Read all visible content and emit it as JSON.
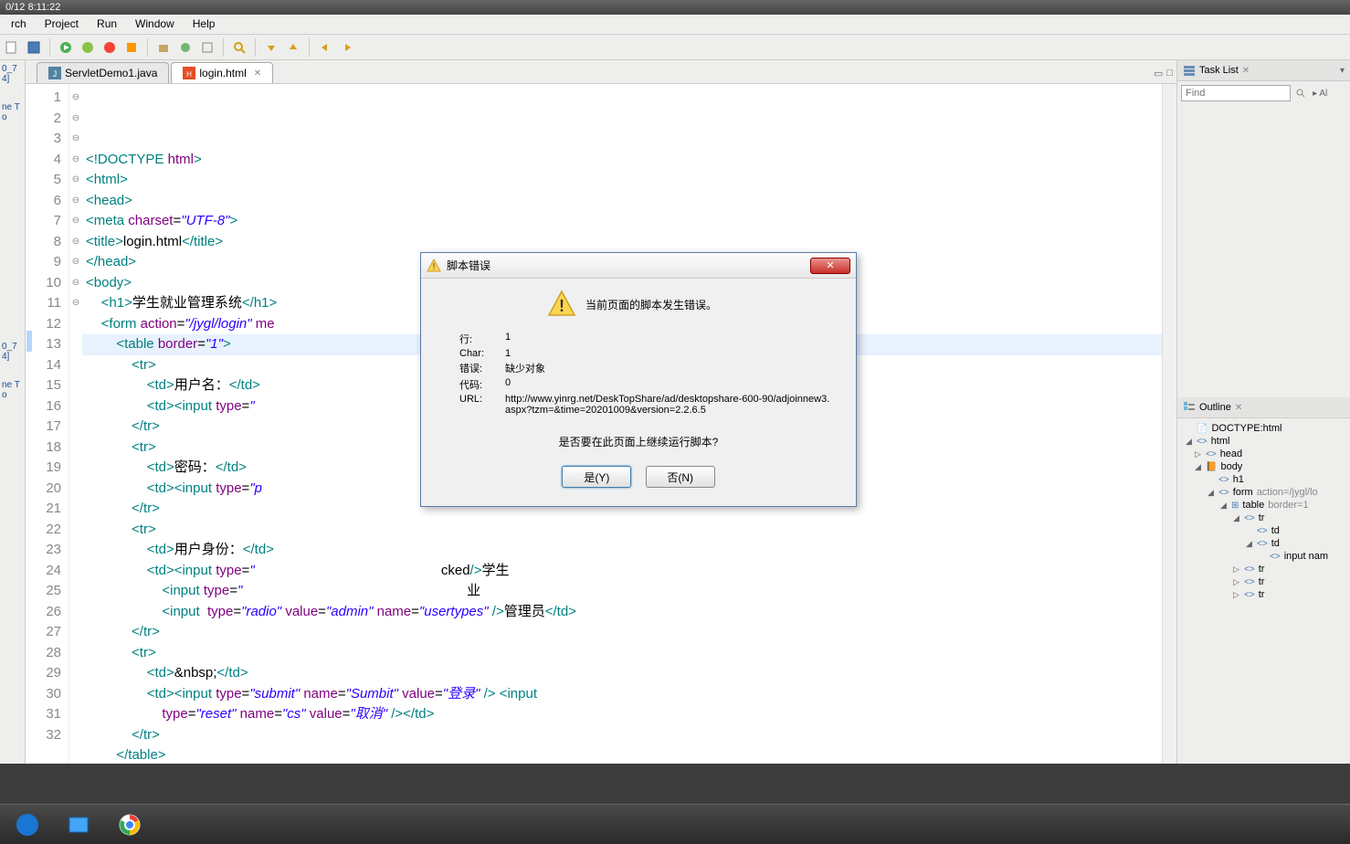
{
  "titlebar": "0/12 8:11:22",
  "menu": {
    "search": "rch",
    "project": "Project",
    "run": "Run",
    "window": "Window",
    "help": "Help"
  },
  "tabs": {
    "t1": "ServletDemo1.java",
    "t2": "login.html"
  },
  "leftpanel": {
    "p1": "0_74]",
    "p2": "ne To",
    "p3": "0_74]",
    "p4": "ne To"
  },
  "code": {
    "lines": [
      {
        "n": "1",
        "f": "",
        "html": "<span class='tag'>&lt;!DOCTYPE</span> <span class='attr'>html</span><span class='tag'>&gt;</span>"
      },
      {
        "n": "2",
        "f": "⊖",
        "html": "<span class='tag'>&lt;html&gt;</span>"
      },
      {
        "n": "3",
        "f": "⊖",
        "html": "<span class='tag'>&lt;head&gt;</span>"
      },
      {
        "n": "4",
        "f": "",
        "html": "<span class='tag'>&lt;meta</span> <span class='attr'>charset</span>=<span class='val'>\"UTF-8\"</span><span class='tag'>&gt;</span>"
      },
      {
        "n": "5",
        "f": "",
        "html": "<span class='tag'>&lt;title&gt;</span><span class='txt'>login.html</span><span class='tag'>&lt;/title&gt;</span>"
      },
      {
        "n": "6",
        "f": "",
        "html": "<span class='tag'>&lt;/head&gt;</span>"
      },
      {
        "n": "7",
        "f": "⊖",
        "html": "<span class='tag'>&lt;body&gt;</span>"
      },
      {
        "n": "8",
        "f": "",
        "html": "    <span class='tag'>&lt;h1&gt;</span><span class='txt'>学生就业管理系统</span><span class='tag'>&lt;/h1&gt;</span>"
      },
      {
        "n": "9",
        "f": "⊖",
        "html": "    <span class='tag'>&lt;form</span> <span class='attr'>action</span>=<span class='val'>\"/jygl/login\"</span> <span class='attr'>me</span>"
      },
      {
        "n": "10",
        "f": "⊖",
        "html": "        <span class='tag'>&lt;table</span> <span class='attr'>border</span>=<span class='val'>\"1\"</span><span class='tag'>&gt;</span>"
      },
      {
        "n": "11",
        "f": "⊖",
        "html": "            <span class='tag'>&lt;tr&gt;</span>"
      },
      {
        "n": "12",
        "f": "",
        "html": "                <span class='tag'>&lt;td&gt;</span><span class='txt'>用户名：</span><span class='tag'>&lt;/td&gt;</span>"
      },
      {
        "n": "13",
        "f": "",
        "html": "                <span class='tag'>&lt;td&gt;&lt;input</span> <span class='attr'>type</span>=<span class='val'>\"</span>"
      },
      {
        "n": "14",
        "f": "",
        "html": "            <span class='tag'>&lt;/tr&gt;</span>"
      },
      {
        "n": "15",
        "f": "⊖",
        "html": "            <span class='tag'>&lt;tr&gt;</span>"
      },
      {
        "n": "16",
        "f": "",
        "html": "                <span class='tag'>&lt;td&gt;</span><span class='txt'>密码：</span><span class='tag'>&lt;/td&gt;</span>"
      },
      {
        "n": "17",
        "f": "",
        "html": "                <span class='tag'>&lt;td&gt;&lt;input</span> <span class='attr'>type</span>=<span class='val'>\"p</span>"
      },
      {
        "n": "18",
        "f": "",
        "html": "            <span class='tag'>&lt;/tr&gt;</span>"
      },
      {
        "n": "19",
        "f": "⊖",
        "html": "            <span class='tag'>&lt;tr&gt;</span>"
      },
      {
        "n": "20",
        "f": "",
        "html": "                <span class='tag'>&lt;td&gt;</span><span class='txt'>用户身份：</span><span class='tag'>&lt;/td&gt;</span>"
      },
      {
        "n": "21",
        "f": "⊖",
        "html": "                <span class='tag'>&lt;td&gt;&lt;input</span> <span class='attr'>type</span>=<span class='val'>\"</span>                                                 cked<span class='tag'>/&gt;</span><span class='txt'>学生</span>"
      },
      {
        "n": "22",
        "f": "",
        "html": "                    <span class='tag'>&lt;input</span> <span class='attr'>type</span>=<span class='val'>\"</span>                                                           <span class='txt'>业</span>"
      },
      {
        "n": "23",
        "f": "",
        "html": "                    <span class='tag'>&lt;input</span>  <span class='attr'>type</span>=<span class='val'>\"radio\"</span> <span class='attr'>value</span>=<span class='val'>\"admin\"</span> <span class='attr'>name</span>=<span class='val'>\"usertypes\"</span> <span class='tag'>/&gt;</span><span class='txt'>管理员</span><span class='tag'>&lt;/td&gt;</span>"
      },
      {
        "n": "24",
        "f": "",
        "html": "            <span class='tag'>&lt;/tr&gt;</span>"
      },
      {
        "n": "25",
        "f": "⊖",
        "html": "            <span class='tag'>&lt;tr&gt;</span>"
      },
      {
        "n": "26",
        "f": "",
        "html": "                <span class='tag'>&lt;td&gt;</span>&amp;nbsp;<span class='tag'>&lt;/td&gt;</span>"
      },
      {
        "n": "27",
        "f": "⊖",
        "html": "                <span class='tag'>&lt;td&gt;&lt;input</span> <span class='attr'>type</span>=<span class='val'>\"submit\"</span> <span class='attr'>name</span>=<span class='val'>\"Sumbit\"</span> <span class='attr'>value</span>=<span class='val'>\"登录\"</span> <span class='tag'>/&gt;</span> <span class='tag'>&lt;input</span>"
      },
      {
        "n": "28",
        "f": "",
        "html": "                    <span class='attr'>type</span>=<span class='val'>\"reset\"</span> <span class='attr'>name</span>=<span class='val'>\"cs\"</span> <span class='attr'>value</span>=<span class='val'>\"取消\"</span> <span class='tag'>/&gt;&lt;/td&gt;</span>"
      },
      {
        "n": "29",
        "f": "",
        "html": "            <span class='tag'>&lt;/tr&gt;</span>"
      },
      {
        "n": "30",
        "f": "",
        "html": "        <span class='tag'>&lt;/table&gt;</span>"
      },
      {
        "n": "31",
        "f": "",
        "html": "    <span class='tag'>&lt;/form&gt;</span>"
      },
      {
        "n": "32",
        "f": "",
        "html": "<span class='tag'>&lt;/body&gt;</span>"
      }
    ]
  },
  "tasklist": {
    "label": "Task List",
    "find": "Find",
    "all": "Al"
  },
  "outline": {
    "label": "Outline",
    "items": [
      {
        "ind": 0,
        "tri": "",
        "icon": "📄",
        "text": "DOCTYPE:html"
      },
      {
        "ind": 0,
        "tri": "◢",
        "icon": "<>",
        "text": "html"
      },
      {
        "ind": 1,
        "tri": "▷",
        "icon": "<>",
        "text": "head"
      },
      {
        "ind": 1,
        "tri": "◢",
        "icon": "📙",
        "text": "body"
      },
      {
        "ind": 2,
        "tri": "",
        "icon": "<>",
        "text": "h1"
      },
      {
        "ind": 2,
        "tri": "◢",
        "icon": "<>",
        "text": "form",
        "attr": " action=/jygl/lo"
      },
      {
        "ind": 3,
        "tri": "◢",
        "icon": "⊞",
        "text": "table",
        "attr": " border=1"
      },
      {
        "ind": 4,
        "tri": "◢",
        "icon": "<>",
        "text": "tr"
      },
      {
        "ind": 5,
        "tri": "",
        "icon": "<>",
        "text": "td"
      },
      {
        "ind": 5,
        "tri": "◢",
        "icon": "<>",
        "text": "td"
      },
      {
        "ind": 6,
        "tri": "",
        "icon": "<>",
        "text": "input nam"
      },
      {
        "ind": 4,
        "tri": "▷",
        "icon": "<>",
        "text": "tr"
      },
      {
        "ind": 4,
        "tri": "▷",
        "icon": "<>",
        "text": "tr"
      },
      {
        "ind": 4,
        "tri": "▷",
        "icon": "<>",
        "text": "tr"
      }
    ]
  },
  "dialog": {
    "title": "脚本错误",
    "headline": "当前页面的脚本发生错误。",
    "row_line_lbl": "行:",
    "row_line_val": "1",
    "row_char_lbl": "Char:",
    "row_char_val": "1",
    "row_err_lbl": "错误:",
    "row_err_val": "缺少对象",
    "row_code_lbl": "代码:",
    "row_code_val": "0",
    "row_url_lbl": "URL:",
    "row_url_val": "http://www.yinrg.net/DeskTopShare/ad/desktopshare-600-90/adjoinnew3.aspx?tzm=&time=20201009&version=2.2.6.5",
    "question": "是否要在此页面上继续运行脚本?",
    "yes": "是(Y)",
    "no": "否(N)"
  }
}
